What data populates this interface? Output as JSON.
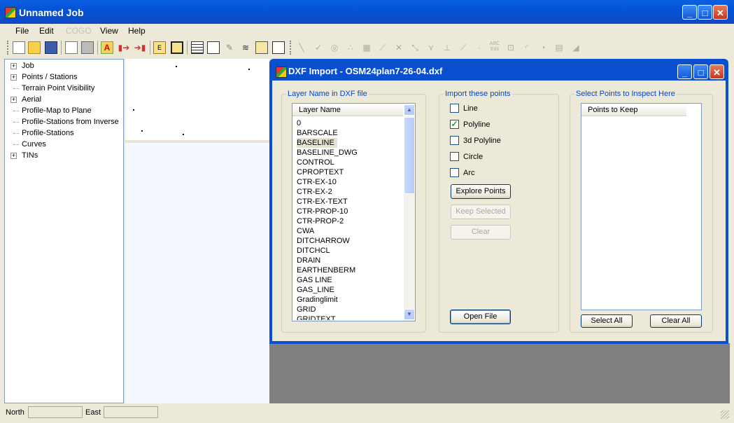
{
  "window": {
    "title": "Unnamed Job"
  },
  "menu": [
    {
      "label": "File",
      "enabled": true
    },
    {
      "label": "Edit",
      "enabled": true
    },
    {
      "label": "COGO",
      "enabled": false
    },
    {
      "label": "View",
      "enabled": true
    },
    {
      "label": "Help",
      "enabled": true
    }
  ],
  "tree": [
    {
      "label": "Job",
      "expandable": true
    },
    {
      "label": "Points / Stations",
      "expandable": true
    },
    {
      "label": "Terrain Point Visibility",
      "expandable": false
    },
    {
      "label": "Aerial",
      "expandable": true
    },
    {
      "label": "Profile-Map to Plane",
      "expandable": false
    },
    {
      "label": "Profile-Stations from Inverse",
      "expandable": false
    },
    {
      "label": "Profile-Stations",
      "expandable": false
    },
    {
      "label": "Curves",
      "expandable": false
    },
    {
      "label": "TINs",
      "expandable": true
    }
  ],
  "status": {
    "north_label": "North",
    "north_value": "",
    "east_label": "East",
    "east_value": ""
  },
  "dialog": {
    "title": "DXF Import - OSM24plan7-26-04.dxf",
    "layer_group": {
      "label": "Layer Name in DXF file",
      "column_header": "Layer Name",
      "selected": "BASELINE",
      "items": [
        "0",
        "BARSCALE",
        "BASELINE",
        "BASELINE_DWG",
        "CONTROL",
        "CPROPTEXT",
        "CTR-EX-10",
        "CTR-EX-2",
        "CTR-EX-TEXT",
        "CTR-PROP-10",
        "CTR-PROP-2",
        "CWA",
        "DITCHARROW",
        "DITCHCL",
        "DRAIN",
        "EARTHENBERM",
        "GAS LINE",
        "GAS_LINE",
        "Gradinglimit",
        "GRID",
        "GRIDTEXT"
      ]
    },
    "import_group": {
      "label": "Import these points",
      "options": [
        {
          "label": "Line",
          "checked": false
        },
        {
          "label": "Polyline",
          "checked": true
        },
        {
          "label": "3d Polyline",
          "checked": false
        },
        {
          "label": "Circle",
          "checked": false
        },
        {
          "label": "Arc",
          "checked": false
        }
      ],
      "explore_label": "Explore Points",
      "keep_label": "Keep Selected",
      "clear_label": "Clear",
      "open_label": "Open File"
    },
    "inspect_group": {
      "label": "Select Points to Inspect Here",
      "column_header": "Points to Keep",
      "select_all_label": "Select  All",
      "clear_all_label": "Clear All"
    }
  }
}
